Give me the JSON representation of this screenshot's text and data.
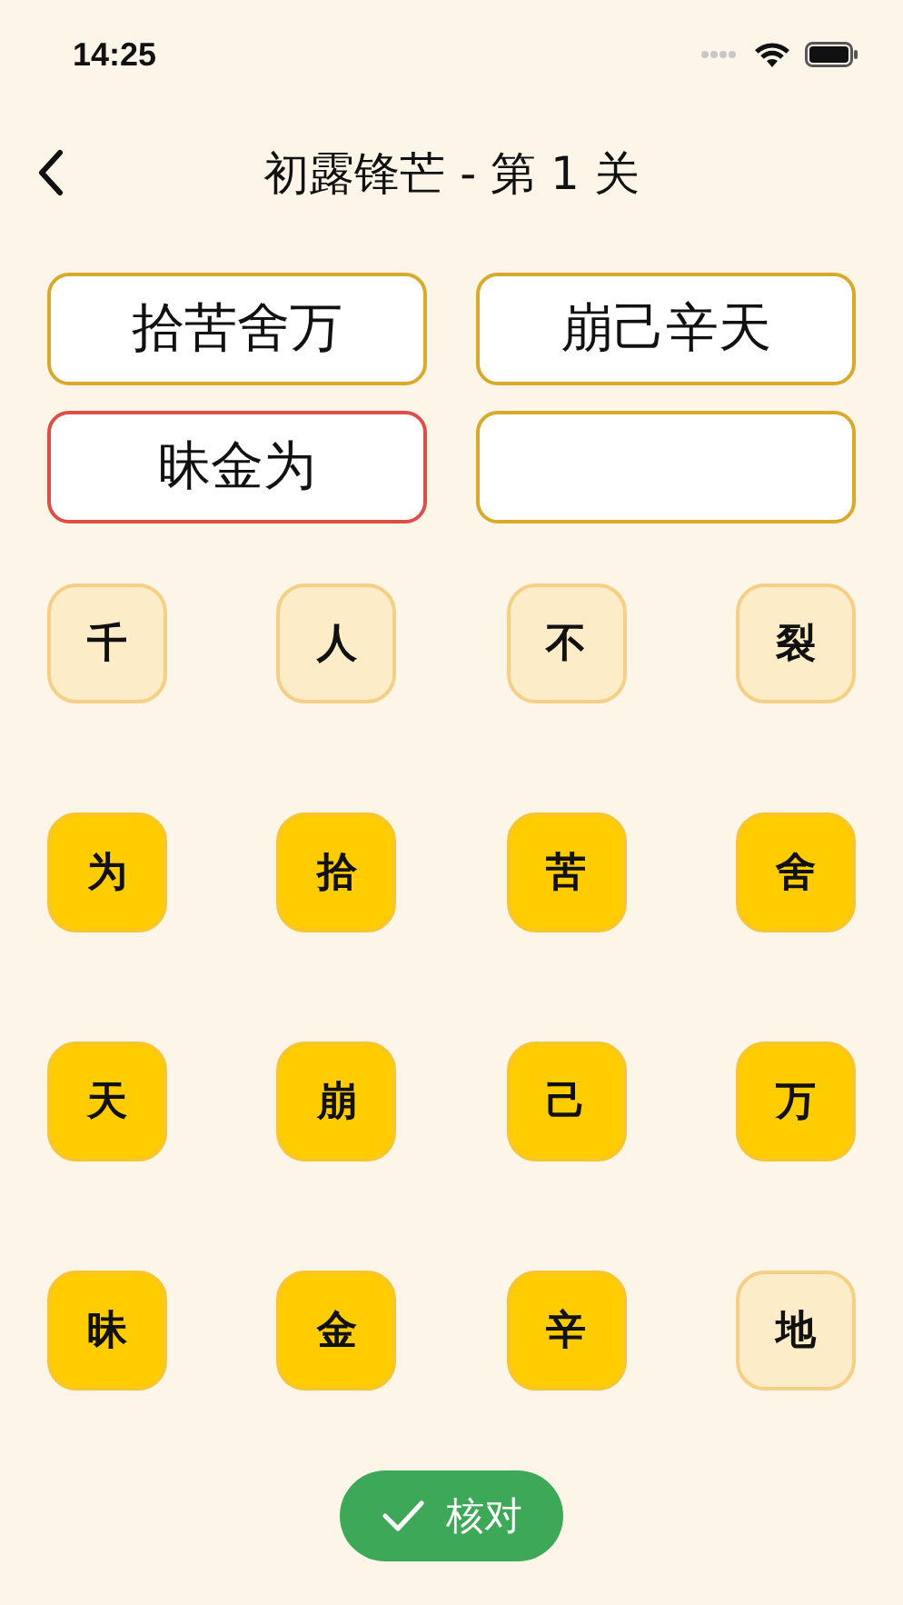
{
  "status_bar": {
    "time": "14:25"
  },
  "header": {
    "title": "初露锋芒 - 第 1 关"
  },
  "answers": [
    {
      "text": "拾苦舍万",
      "wrong": false
    },
    {
      "text": "崩己辛天",
      "wrong": false
    },
    {
      "text": "昧金为",
      "wrong": true
    },
    {
      "wrong": false
    }
  ],
  "tiles": [
    {
      "char": "千",
      "selected": false
    },
    {
      "char": "人",
      "selected": false
    },
    {
      "char": "不",
      "selected": false
    },
    {
      "char": "裂",
      "selected": false
    },
    {
      "char": "为",
      "selected": true
    },
    {
      "char": "拾",
      "selected": true
    },
    {
      "char": "苦",
      "selected": true
    },
    {
      "char": "舍",
      "selected": true
    },
    {
      "char": "天",
      "selected": true
    },
    {
      "char": "崩",
      "selected": true
    },
    {
      "char": "己",
      "selected": true
    },
    {
      "char": "万",
      "selected": true
    },
    {
      "char": "昧",
      "selected": true
    },
    {
      "char": "金",
      "selected": true
    },
    {
      "char": "辛",
      "selected": true
    },
    {
      "char": "地",
      "selected": false
    }
  ],
  "verify_button": {
    "label": "核对"
  }
}
